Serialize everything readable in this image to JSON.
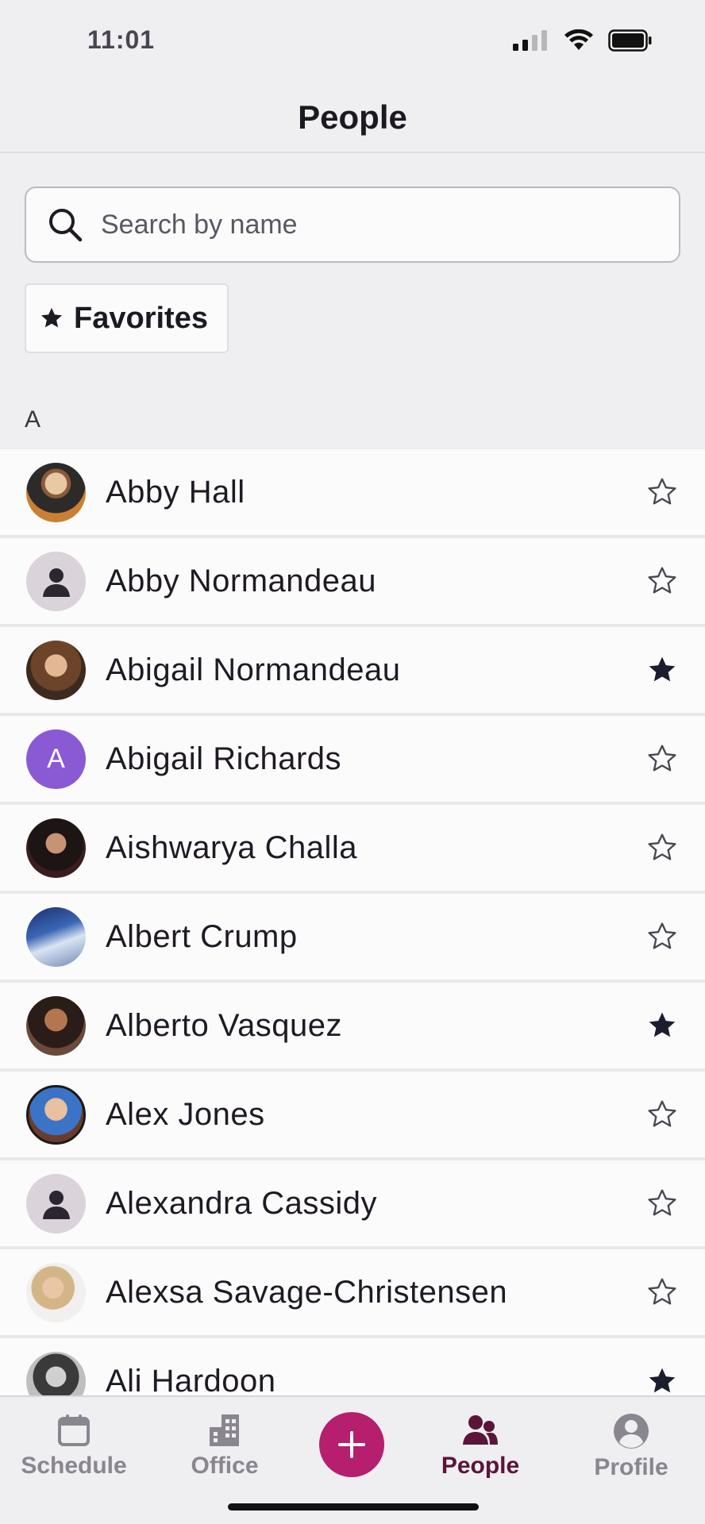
{
  "status_bar": {
    "time": "11:01"
  },
  "header": {
    "title": "People"
  },
  "search": {
    "placeholder": "Search by name"
  },
  "filter": {
    "favorites_label": "Favorites"
  },
  "section": {
    "letter": "A"
  },
  "people": [
    {
      "name": "Abby Hall",
      "avatar": "photo",
      "favorite": false
    },
    {
      "name": "Abby Normandeau",
      "avatar": "placeholder",
      "favorite": false
    },
    {
      "name": "Abigail Normandeau",
      "avatar": "photo",
      "favorite": true
    },
    {
      "name": "Abigail Richards",
      "avatar": "initial",
      "initial": "A",
      "favorite": false
    },
    {
      "name": "Aishwarya Challa",
      "avatar": "photo",
      "favorite": false
    },
    {
      "name": "Albert Crump",
      "avatar": "photo",
      "favorite": false
    },
    {
      "name": "Alberto Vasquez",
      "avatar": "photo",
      "favorite": true
    },
    {
      "name": "Alex Jones",
      "avatar": "photo",
      "favorite": false
    },
    {
      "name": "Alexandra Cassidy",
      "avatar": "placeholder",
      "favorite": false
    },
    {
      "name": "Alexsa Savage-Christensen",
      "avatar": "photo",
      "favorite": false
    },
    {
      "name": "Ali Hardoon",
      "avatar": "photo",
      "favorite": true
    }
  ],
  "tabs": [
    {
      "label": "Schedule",
      "icon": "calendar-icon",
      "active": false
    },
    {
      "label": "Office",
      "icon": "building-icon",
      "active": false
    },
    {
      "label": "People",
      "icon": "people-icon",
      "active": true
    },
    {
      "label": "Profile",
      "icon": "user-circle-icon",
      "active": false
    }
  ],
  "fab": {
    "icon": "plus-icon"
  },
  "colors": {
    "accent": "#b51f6e",
    "active_tab": "#5b1538",
    "inactive_tab": "#8a8690",
    "initial_avatar": "#8a5ad4",
    "placeholder_avatar": "#dad3da"
  }
}
